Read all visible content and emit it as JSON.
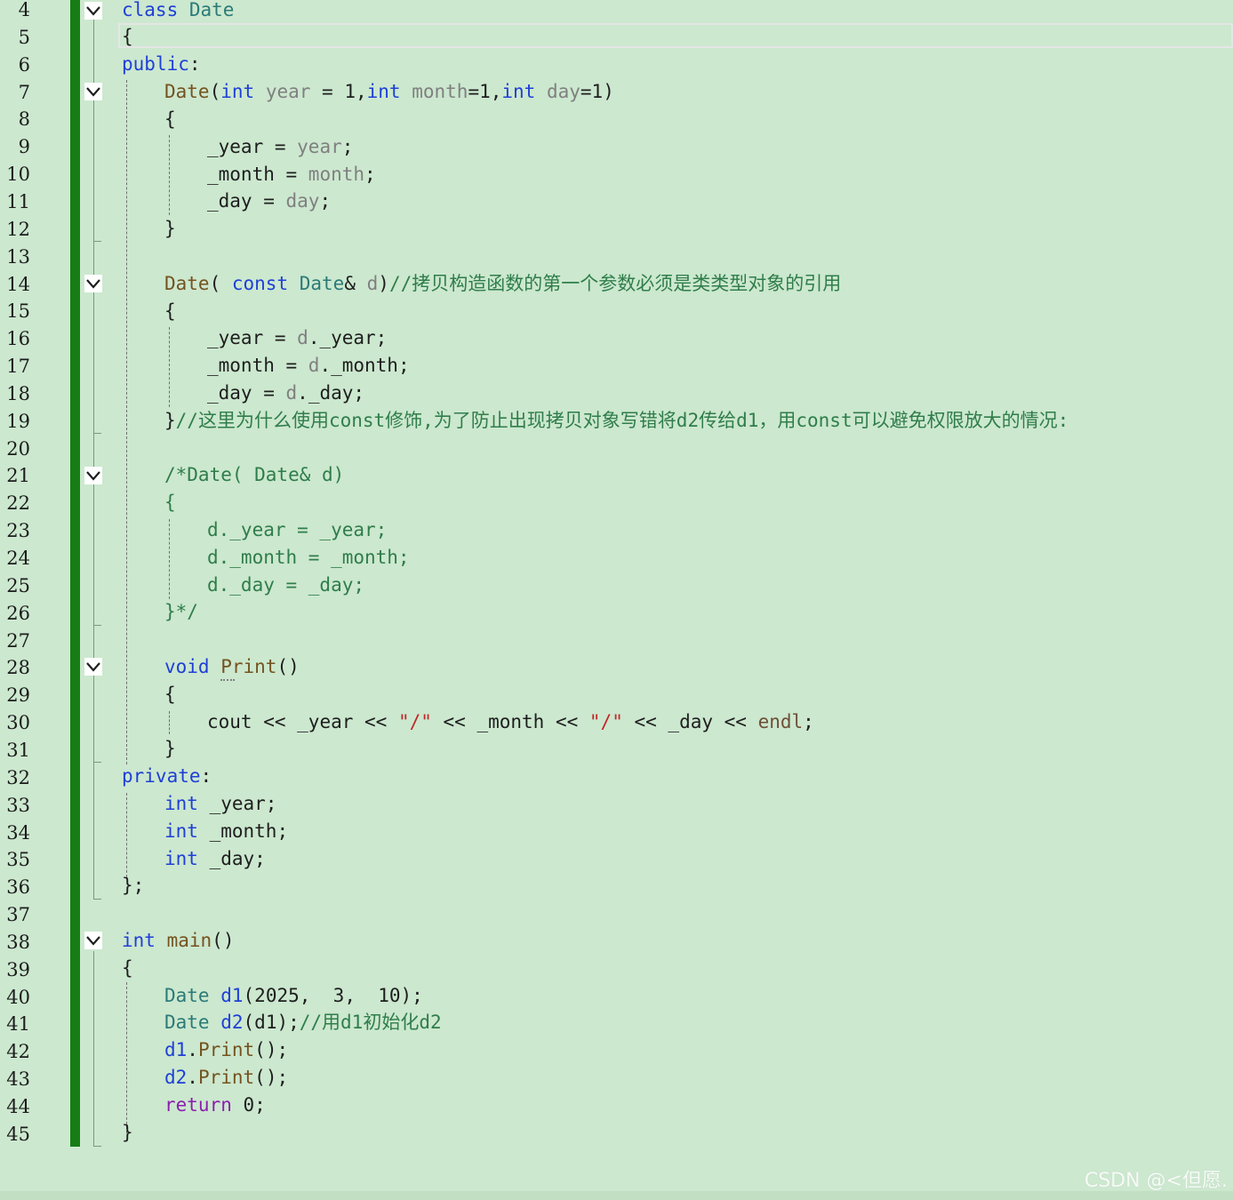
{
  "editor": {
    "background": "#cce8cf",
    "change_bar_color": "#157d13",
    "line_numbers": [
      "4",
      "5",
      "6",
      "7",
      "8",
      "9",
      "10",
      "11",
      "12",
      "13",
      "14",
      "15",
      "16",
      "17",
      "18",
      "19",
      "20",
      "21",
      "22",
      "23",
      "24",
      "25",
      "26",
      "27",
      "28",
      "29",
      "30",
      "31",
      "32",
      "33",
      "34",
      "35",
      "36",
      "37",
      "38",
      "39",
      "40",
      "41",
      "42",
      "43",
      "44",
      "45"
    ],
    "code": {
      "l4": {
        "kw": "class",
        "name": "Date"
      },
      "l5": {
        "brace": "{"
      },
      "l6": {
        "kw": "public",
        "colon": ":"
      },
      "l7": {
        "fn": "Date",
        "p1": "(",
        "kw1": "int",
        "prm1": "year",
        "eq1": " = 1,",
        "kw2": "int",
        "prm2": "month",
        "eq2": "=1,",
        "kw3": "int",
        "prm3": "day",
        "eq3": "=1)"
      },
      "l8": {
        "brace": "{"
      },
      "l9": {
        "mem": "_year",
        "op": " = ",
        "prm": "year",
        "semi": ";"
      },
      "l10": {
        "mem": "_month",
        "op": " = ",
        "prm": "month",
        "semi": ";"
      },
      "l11": {
        "mem": "_day",
        "op": " = ",
        "prm": "day",
        "semi": ";"
      },
      "l12": {
        "brace": "}"
      },
      "l14": {
        "fn": "Date",
        "p1": "( ",
        "kw": "const",
        "ty": "Date",
        "amp": "& ",
        "prm": "d",
        "p2": ")",
        "comment": "//拷贝构造函数的第一个参数必须是类类型对象的引用"
      },
      "l15": {
        "brace": "{"
      },
      "l16": {
        "mem": "_year",
        "op": " = ",
        "prm": "d",
        "rest": "._year;"
      },
      "l17": {
        "mem": "_month",
        "op": " = ",
        "prm": "d",
        "rest": "._month;"
      },
      "l18": {
        "mem": "_day",
        "op": " = ",
        "prm": "d",
        "rest": "._day;"
      },
      "l19": {
        "brace": "}",
        "comment": "//这里为什么使用const修饰,为了防止出现拷贝对象写错将d2传给d1，用const可以避免权限放大的情况:"
      },
      "l21": {
        "comment": "/*Date( Date& d)"
      },
      "l22": {
        "comment": "{"
      },
      "l23": {
        "comment": "d._year = _year;"
      },
      "l24": {
        "comment": "d._month = _month;"
      },
      "l25": {
        "comment": "d._day = _day;"
      },
      "l26": {
        "comment": "}*/"
      },
      "l28": {
        "kw": "void",
        "fn": "Print",
        "parens": "()"
      },
      "l29": {
        "brace": "{"
      },
      "l30": {
        "cout": "cout",
        "op1": " << ",
        "m1": "_year",
        "op2": " << ",
        "s1": "\"/\"",
        "op3": " << ",
        "m2": "_month",
        "op4": " << ",
        "s2": "\"/\"",
        "op5": " << ",
        "m3": "_day",
        "op6": " << ",
        "endl": "endl",
        "semi": ";"
      },
      "l31": {
        "brace": "}"
      },
      "l32": {
        "kw": "private",
        "colon": ":"
      },
      "l33": {
        "kw": "int",
        "name": " _year;"
      },
      "l34": {
        "kw": "int",
        "name": " _month;"
      },
      "l35": {
        "kw": "int",
        "name": " _day;"
      },
      "l36": {
        "brace": "};"
      },
      "l38": {
        "kw": "int",
        "fn": "main",
        "parens": "()"
      },
      "l39": {
        "brace": "{"
      },
      "l40": {
        "ty": "Date",
        "var": "d1",
        "args": "(2025,  3,  10);"
      },
      "l41": {
        "ty": "Date",
        "var": "d2",
        "args": "(d1);",
        "comment": "//用d1初始化d2"
      },
      "l42": {
        "var": "d1",
        "dot": ".",
        "fn": "Print",
        "rest": "();"
      },
      "l43": {
        "var": "d2",
        "dot": ".",
        "fn": "Print",
        "rest": "();"
      },
      "l44": {
        "kw": "return",
        "rest": " 0;"
      },
      "l45": {
        "brace": "}"
      }
    }
  },
  "fold_icons": [
    "chevron-down-icon"
  ],
  "watermark": "CSDN @<但愿."
}
